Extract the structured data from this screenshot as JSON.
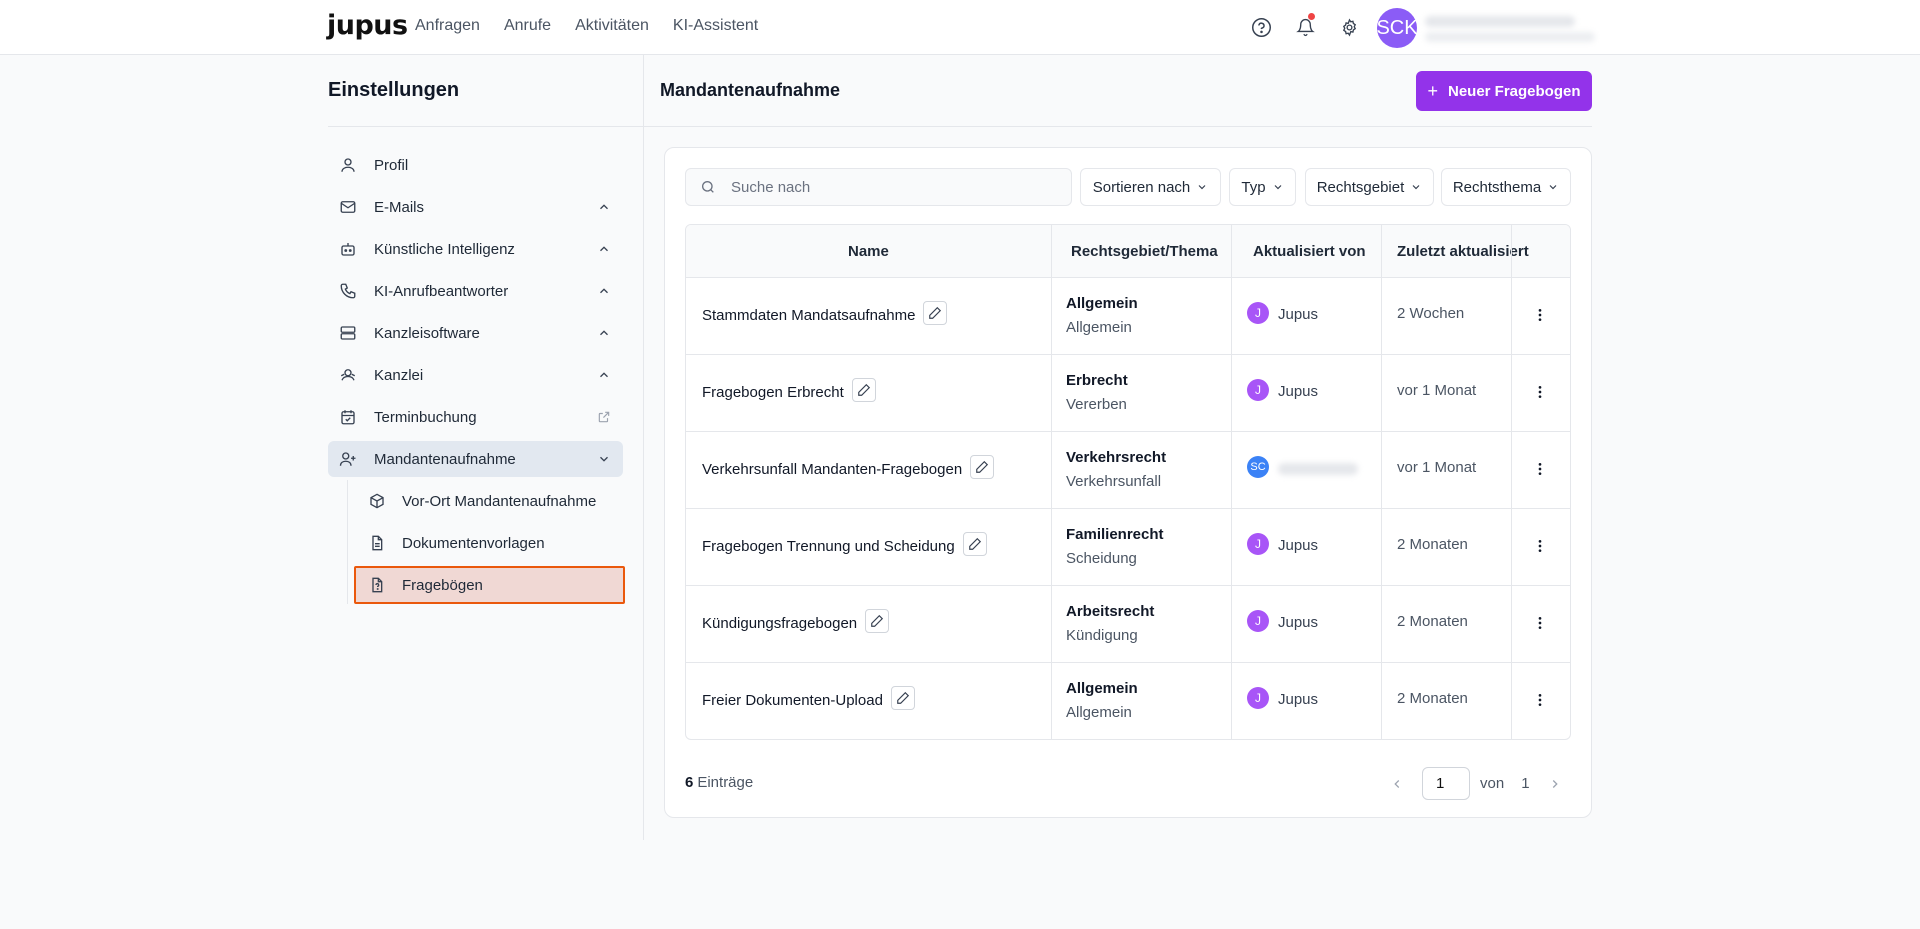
{
  "brand": {
    "logo": "jupus"
  },
  "nav": [
    "Anfragen",
    "Anrufe",
    "Aktivitäten",
    "KI-Assistent"
  ],
  "user": {
    "initials": "SCK"
  },
  "sidebar": {
    "title": "Einstellungen",
    "items": [
      {
        "label": "Profil",
        "icon": "user-icon"
      },
      {
        "label": "E-Mails",
        "icon": "mail-icon",
        "expandable": true
      },
      {
        "label": "Künstliche Intelligenz",
        "icon": "robot-icon",
        "expandable": true
      },
      {
        "label": "KI-Anrufbeantworter",
        "icon": "phone-icon",
        "expandable": true
      },
      {
        "label": "Kanzleisoftware",
        "icon": "server-icon",
        "expandable": true
      },
      {
        "label": "Kanzlei",
        "icon": "firm-icon",
        "expandable": true
      },
      {
        "label": "Terminbuchung",
        "icon": "calendar-check-icon",
        "external": true
      },
      {
        "label": "Mandantenaufnahme",
        "icon": "user-plus-icon",
        "expanded": true
      }
    ],
    "subitems": [
      {
        "label": "Vor-Ort Mandantenaufnahme",
        "icon": "package-icon"
      },
      {
        "label": "Dokumentenvorlagen",
        "icon": "document-icon"
      },
      {
        "label": "Fragebögen",
        "icon": "questionnaire-icon",
        "selected": true
      }
    ]
  },
  "main": {
    "title": "Mandantenaufnahme",
    "new_button": "Neuer Fragebogen",
    "search_placeholder": "Suche nach",
    "filters": [
      "Sortieren nach",
      "Typ",
      "Rechtsgebiet",
      "Rechtsthema"
    ],
    "columns": [
      "Name",
      "Rechtsgebiet/Thema",
      "Aktualisiert von",
      "Zuletzt aktualisiert"
    ],
    "rows": [
      {
        "name": "Stammdaten Mandatsaufnahme",
        "area": "Allgemein",
        "topic": "Allgemein",
        "user_initial": "J",
        "user": "Jupus",
        "updated": "2 Wochen"
      },
      {
        "name": "Fragebogen Erbrecht",
        "area": "Erbrecht",
        "topic": "Vererben",
        "user_initial": "J",
        "user": "Jupus",
        "updated": "vor 1 Monat"
      },
      {
        "name": "Verkehrsunfall Mandanten-Fragebogen",
        "area": "Verkehrsrecht",
        "topic": "Verkehrsunfall",
        "user_initial": "SC",
        "user": "",
        "updated": "vor 1 Monat"
      },
      {
        "name": "Fragebogen Trennung und Scheidung",
        "area": "Familienrecht",
        "topic": "Scheidung",
        "user_initial": "J",
        "user": "Jupus",
        "updated": "2 Monaten"
      },
      {
        "name": "Kündigungsfragebogen",
        "area": "Arbeitsrecht",
        "topic": "Kündigung",
        "user_initial": "J",
        "user": "Jupus",
        "updated": "2 Monaten"
      },
      {
        "name": "Freier Dokumenten-Upload",
        "area": "Allgemein",
        "topic": "Allgemein",
        "user_initial": "J",
        "user": "Jupus",
        "updated": "2 Monaten"
      }
    ],
    "footer": {
      "count": "6",
      "count_label": "Einträge",
      "page": "1",
      "of_label": "von",
      "total_pages": "1"
    }
  },
  "colors": {
    "accent": "#9333ea",
    "selected_outline": "#ea580c",
    "user_avatar": "#8b5cf6"
  }
}
